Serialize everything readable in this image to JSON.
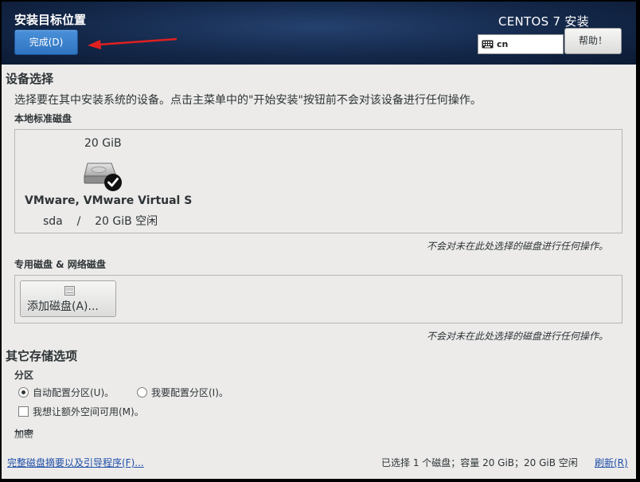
{
  "header": {
    "title": "安装目标位置",
    "done_label": "完成(D)",
    "product": "CENTOS 7 安装",
    "keyboard_layout": "cn",
    "help_label": "帮助！"
  },
  "device_selection": {
    "heading": "设备选择",
    "description": "选择要在其中安装系统的设备。点击主菜单中的\"开始安装\"按钮前不会对该设备进行任何操作。",
    "local_disks": {
      "heading": "本地标准磁盘",
      "disks": [
        {
          "size": "20 GiB",
          "name": "VMware, VMware Virtual S",
          "device": "sda",
          "separator": "/",
          "free": "20 GiB 空闲",
          "selected": true
        }
      ],
      "note": "不会对未在此处选择的磁盘进行任何操作。"
    },
    "network_disks": {
      "heading": "专用磁盘 & 网络磁盘",
      "add_button_label": "添加磁盘(A)...",
      "note": "不会对未在此处选择的磁盘进行任何操作。"
    }
  },
  "other_storage": {
    "heading": "其它存储选项",
    "partitioning": {
      "heading": "分区",
      "options": [
        {
          "label": "自动配置分区(U)。",
          "selected": true
        },
        {
          "label": "我要配置分区(I)。",
          "selected": false
        }
      ],
      "extra_space": {
        "label": "我想让额外空间可用(M)。",
        "checked": false
      }
    },
    "encryption_heading": "加密"
  },
  "footer": {
    "summary_link": "完整磁盘摘要以及引导程序(F)...",
    "status": "已选择 1 个磁盘；容量 20 GiB；20 GiB 空闲",
    "refresh_link": "刷新(R)"
  },
  "colors": {
    "header_bg": "#14284a",
    "primary_button": "#2f74c0",
    "annotation_arrow": "#e02020",
    "link": "#1f4fa8"
  }
}
